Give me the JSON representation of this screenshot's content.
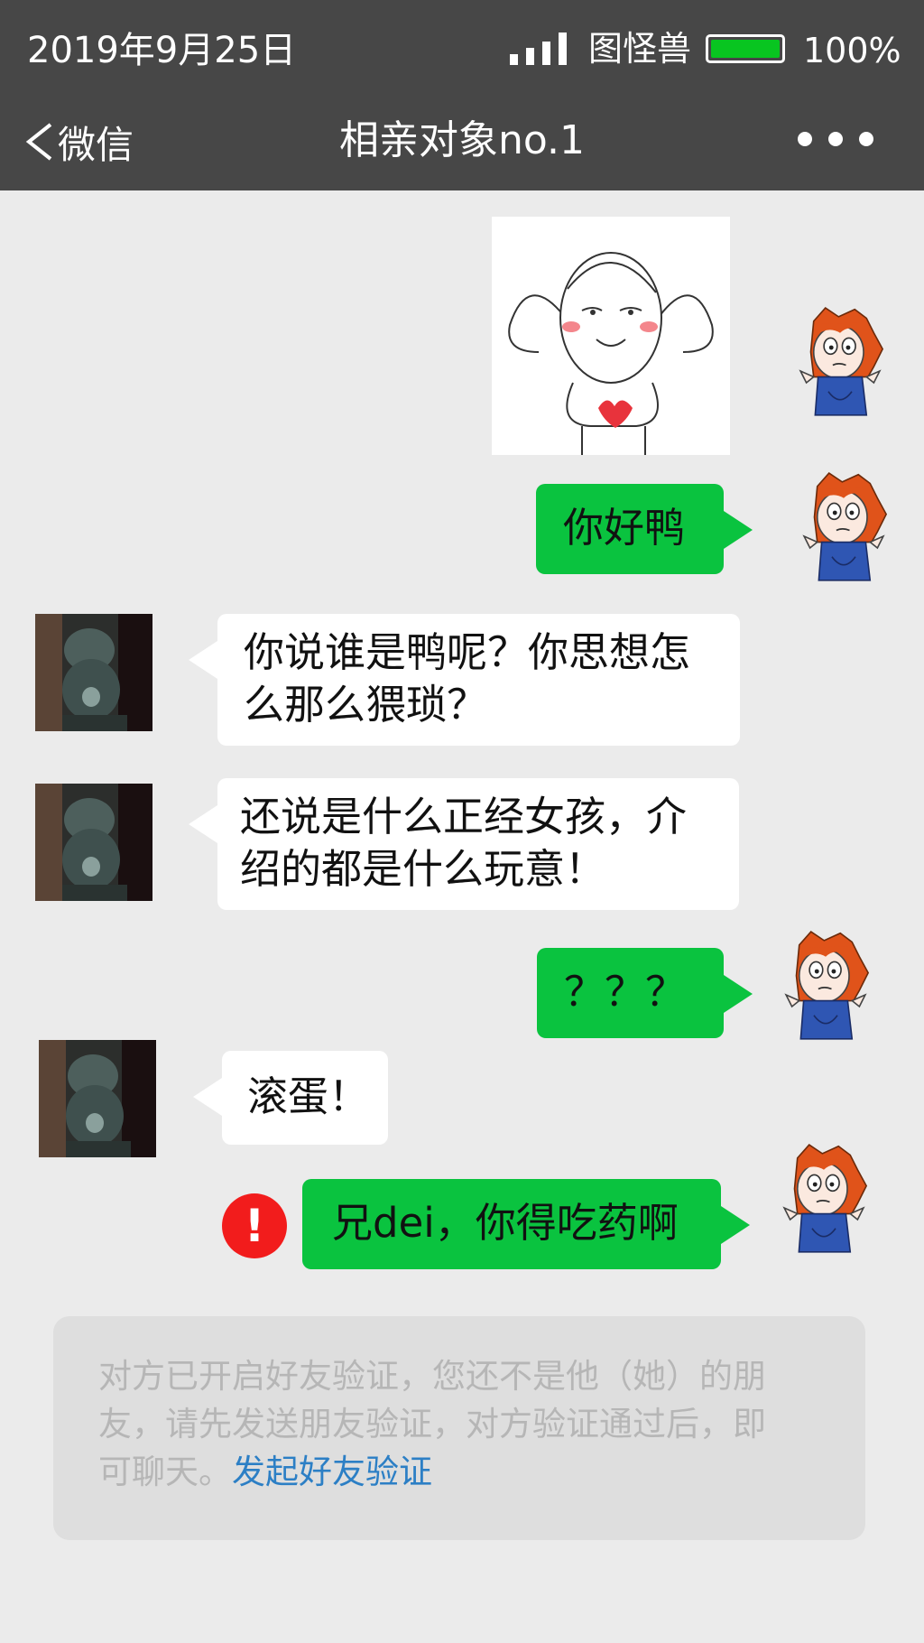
{
  "status_bar": {
    "date": "2019年9月25日",
    "carrier": "图怪兽",
    "battery_percent": "100%",
    "battery_level": 1.0
  },
  "nav": {
    "back_label": "微信",
    "title": "相亲对象no.1"
  },
  "messages": [
    {
      "from": "me",
      "type": "sticker"
    },
    {
      "from": "me",
      "text": "你好鸭"
    },
    {
      "from": "them",
      "lines": [
        "你说谁是鸭呢？你思想怎",
        "么那么猥琐？"
      ]
    },
    {
      "from": "them",
      "lines": [
        "还说是什么正经女孩，介",
        "绍的都是什么玩意！"
      ]
    },
    {
      "from": "me",
      "text": "？？？"
    },
    {
      "from": "them",
      "text": "滚蛋！"
    },
    {
      "from": "me",
      "text": "兄dei，你得吃药啊",
      "failed": true,
      "error_icon": "!"
    }
  ],
  "notice": {
    "lines": [
      "对方已开启好友验证，您还不是他（她）的朋",
      "友，请先发送朋友验证，对方验证通过后，即"
    ],
    "last_line_prefix": "可聊天。",
    "link": "发起好友验证"
  },
  "colors": {
    "header_bg": "#474747",
    "chat_bg": "#ebebeb",
    "out_bubble": "#0ac33f",
    "in_bubble": "#ffffff",
    "battery_fill": "#08c520",
    "error_red": "#f21c1c",
    "link_blue": "#2c7fc5"
  },
  "icons": [
    "signal-icon",
    "battery-icon",
    "back-chevron-icon",
    "more-dots-icon",
    "error-icon"
  ]
}
